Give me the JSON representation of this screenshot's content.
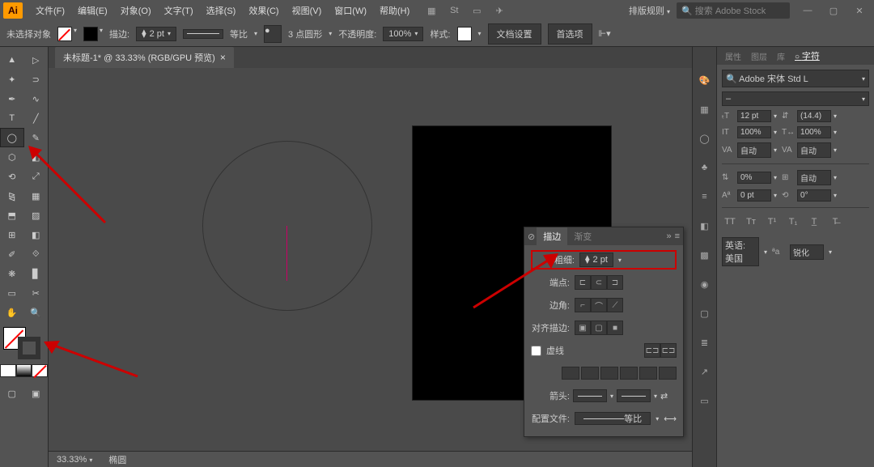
{
  "menu": {
    "items": [
      "文件(F)",
      "编辑(E)",
      "对象(O)",
      "文字(T)",
      "选择(S)",
      "效果(C)",
      "视图(V)",
      "窗口(W)",
      "帮助(H)"
    ],
    "workspace": "排版规则",
    "search_placeholder": "搜索 Adobe Stock"
  },
  "control": {
    "no_selection": "未选择对象",
    "stroke_label": "描边:",
    "stroke_weight": "2 pt",
    "uniform": "等比",
    "brush": "3 点圆形",
    "opacity_label": "不透明度:",
    "opacity": "100%",
    "style_label": "样式:",
    "doc_setup": "文档设置",
    "prefs": "首选项"
  },
  "document": {
    "tab_title": "未标题-1* @ 33.33% (RGB/GPU 预览)",
    "zoom": "33.33%",
    "tool_name": "椭圆"
  },
  "stroke_panel": {
    "tabs": [
      "描边",
      "渐变"
    ],
    "weight_label": "粗细:",
    "weight": "2 pt",
    "cap_label": "端点:",
    "corner_label": "边角:",
    "align_label": "对齐描边:",
    "dash_label": "虚线",
    "arrow_label": "箭头:",
    "profile_label": "配置文件:",
    "profile": "等比"
  },
  "char_panel": {
    "tabs": [
      "属性",
      "图层",
      "库",
      "字符"
    ],
    "font": "Adobe 宋体 Std L",
    "size": "12 pt",
    "leading": "(14.4)",
    "vscale": "100%",
    "hscale": "100%",
    "kerning": "自动",
    "tracking": "自动",
    "baseline": "0%",
    "baseline2": "自动",
    "shift": "0 pt",
    "rotation": "0°",
    "lang_label": "英语: 美国",
    "aa_label": "锐化"
  }
}
